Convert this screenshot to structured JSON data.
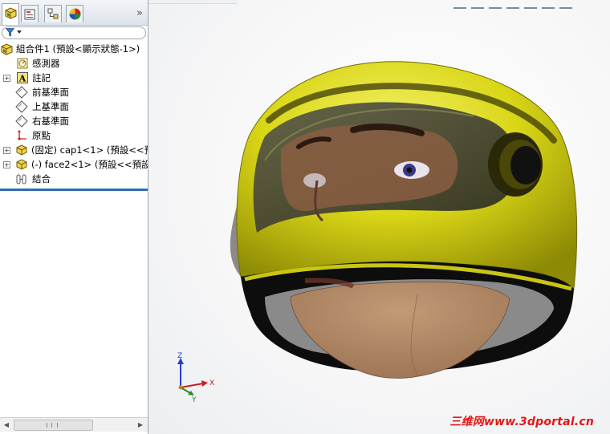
{
  "panel_tabs": [
    {
      "name": "featuremanager-tab",
      "active": true
    },
    {
      "name": "propertymanager-tab",
      "active": false
    },
    {
      "name": "configurationmanager-tab",
      "active": false
    },
    {
      "name": "displaymanager-tab",
      "active": false
    }
  ],
  "tree": {
    "root": "組合件1  (預設<顯示狀態-1>)",
    "items": [
      {
        "label": "感測器",
        "icon": "sensor-icon",
        "expandable": false
      },
      {
        "label": "註記",
        "icon": "annotation-icon",
        "expandable": true
      },
      {
        "label": "前基準面",
        "icon": "plane-icon",
        "expandable": false
      },
      {
        "label": "上基準面",
        "icon": "plane-icon",
        "expandable": false
      },
      {
        "label": "右基準面",
        "icon": "plane-icon",
        "expandable": false
      },
      {
        "label": "原點",
        "icon": "origin-icon",
        "expandable": false
      },
      {
        "label": "(固定) cap1<1> (預設<<預",
        "icon": "part-icon",
        "expandable": true
      },
      {
        "label": "(-) face2<1> (預設<<預設",
        "icon": "part-icon",
        "expandable": true
      },
      {
        "label": "結合",
        "icon": "mates-icon",
        "expandable": false
      }
    ]
  },
  "triad": {
    "x": "X",
    "y": "Y",
    "z": "Z"
  },
  "watermark": "三维网www.3dportal.cn",
  "colors": {
    "helmet_shell": "#d8d81a",
    "visor": "#3a3a2a",
    "skin": "#b08866",
    "selection_blue": "#2f6db5",
    "watermark": "#e01818"
  }
}
